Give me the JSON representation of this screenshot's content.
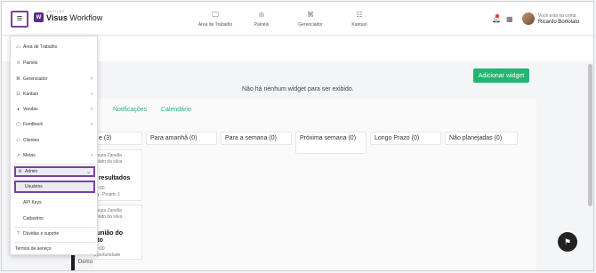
{
  "header": {
    "brand_top": "AUTO BY",
    "brand_strong": "Visus",
    "brand_rest": "Workflow",
    "logo_letter": "W",
    "nav": [
      {
        "label": "Área de Trabalho",
        "icon": "monitor-icon",
        "glyph": "🖵"
      },
      {
        "label": "Painéis",
        "icon": "bar-chart-icon",
        "glyph": "ılı"
      },
      {
        "label": "Gerenciador",
        "icon": "hierarchy-icon",
        "glyph": "⌘"
      },
      {
        "label": "Kanban",
        "icon": "kanban-icon",
        "glyph": "☷"
      }
    ],
    "account_caption": "Você está na conta",
    "account_name": "Ricardo Bortolato",
    "accent": "#7b3fa3"
  },
  "main": {
    "add_widget_label": "Adicionar widget",
    "no_widget_text": "Não há nenhum widget para ser exibido.",
    "tabs": [
      "Notificações",
      "Calendário"
    ],
    "columns": [
      {
        "label": "e (3)"
      },
      {
        "label": "Para amanhã (0)"
      },
      {
        "label": "Para a semana (0)"
      },
      {
        "label": "Próxima semana (0)"
      },
      {
        "label": "Longo Prazo (0)"
      },
      {
        "label": "Não planejadas (0)"
      }
    ],
    "cards": [
      {
        "user_line1": "Souza Zanella",
        "user_line2": "rtolato da silva",
        "title": "e resultados",
        "meta": "00:00",
        "tag_text": "er",
        "project": "Projeto 1"
      },
      {
        "user_line1": "Souza Zanella",
        "user_line2": "rtolato da silva",
        "title_line1": "eunião do",
        "title_line2": "nto",
        "meta": "00:00",
        "project": "Oportunidade"
      }
    ],
    "demo_text": "Demo",
    "green": "#22b573"
  },
  "menu": {
    "items": [
      {
        "label": "Área de Trabalho",
        "icon": "monitor-icon",
        "glyph": "▭",
        "chevron": false
      },
      {
        "label": "Painéis",
        "icon": "bar-chart-icon",
        "glyph": "ıl",
        "chevron": false
      },
      {
        "label": "Gerenciador",
        "icon": "hierarchy-icon",
        "glyph": "⌘",
        "chevron": true
      },
      {
        "label": "Kanban",
        "icon": "kanban-icon",
        "glyph": "☷",
        "chevron": true
      },
      {
        "label": "Vendas",
        "icon": "tag-icon",
        "glyph": "⬧",
        "chevron": true
      },
      {
        "label": "Feedback",
        "icon": "chat-icon",
        "glyph": "▢",
        "chevron": true
      },
      {
        "label": "Clientes",
        "icon": "users-icon",
        "glyph": "⚇",
        "chevron": false
      },
      {
        "label": "Metas",
        "icon": "trend-icon",
        "glyph": "↗",
        "chevron": true
      },
      {
        "label": "Admin",
        "icon": "gear-icon",
        "glyph": "⚙",
        "chevron": true
      },
      {
        "label": "Usuários",
        "icon": "",
        "glyph": "",
        "chevron": false
      },
      {
        "label": "API Keys",
        "icon": "",
        "glyph": "",
        "chevron": false
      },
      {
        "label": "Cadastros",
        "icon": "",
        "glyph": "",
        "chevron": false
      },
      {
        "label": "Dúvidas e suporte",
        "icon": "help-icon",
        "glyph": "?",
        "chevron": false
      },
      {
        "label": "Termos de serviço",
        "icon": "",
        "glyph": "",
        "chevron": false
      }
    ],
    "chevron_glyph": "›",
    "chevron_down_glyph": "⌄"
  }
}
